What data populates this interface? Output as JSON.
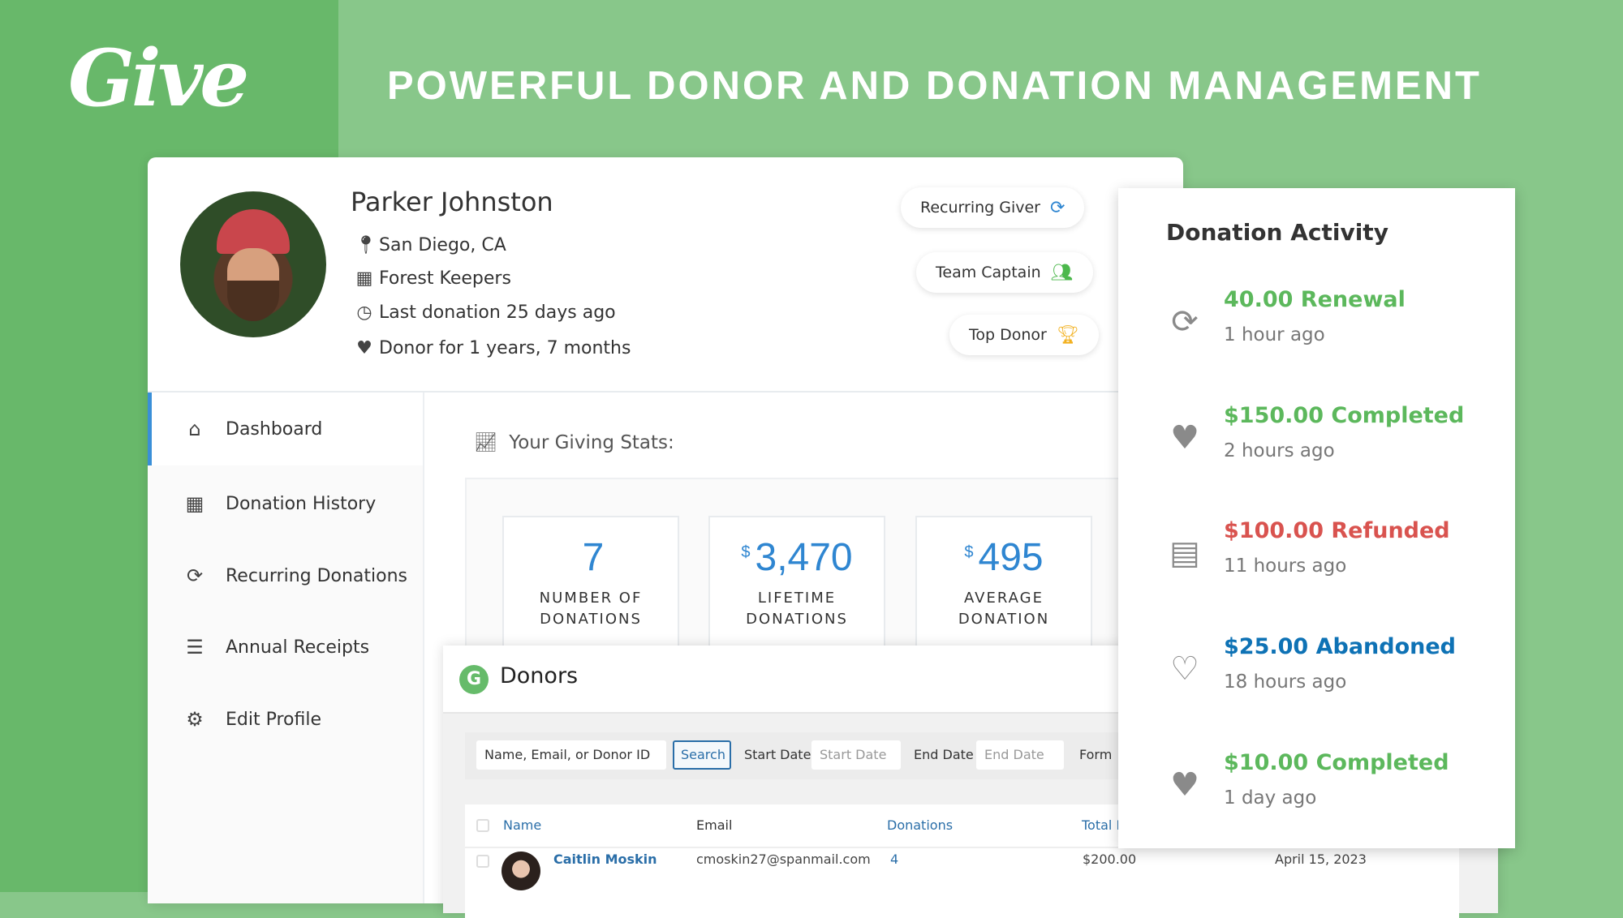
{
  "brand": {
    "logo_text": "Give",
    "headline": "POWERFUL DONOR AND DONATION MANAGEMENT"
  },
  "profile": {
    "name": "Parker Johnston",
    "location": "San Diego, CA",
    "organization": "Forest Keepers",
    "last_donation": "Last donation 25 days ago",
    "donor_since": "Donor for 1 years, 7 months",
    "badges": [
      {
        "label": "Recurring Giver",
        "icon": "sync-icon",
        "color": "#2f86d1"
      },
      {
        "label": "Team Captain",
        "icon": "users-icon",
        "color": "#4cb84c"
      },
      {
        "label": "Top Donor",
        "icon": "trophy-icon",
        "color": "#f2b01e"
      }
    ]
  },
  "sidebar": {
    "items": [
      {
        "label": "Dashboard",
        "icon": "home-icon",
        "active": true
      },
      {
        "label": "Donation History",
        "icon": "calendar-icon"
      },
      {
        "label": "Recurring Donations",
        "icon": "sync-icon"
      },
      {
        "label": "Annual Receipts",
        "icon": "receipt-icon"
      },
      {
        "label": "Edit Profile",
        "icon": "gear-icon"
      }
    ]
  },
  "stats": {
    "title": "Your Giving Stats:",
    "cards": [
      {
        "currency": "",
        "value": "7",
        "label1": "NUMBER OF",
        "label2": "DONATIONS"
      },
      {
        "currency": "$",
        "value": "3,470",
        "label1": "LIFETIME",
        "label2": "DONATIONS"
      },
      {
        "currency": "$",
        "value": "495",
        "label1": "AVERAGE",
        "label2": "DONATION"
      }
    ]
  },
  "donors": {
    "title": "Donors",
    "search_placeholder": "Name, Email, or Donor ID",
    "search_label": "Search",
    "start_date_label": "Start Date",
    "start_date_placeholder": "Start Date",
    "end_date_label": "End Date",
    "end_date_placeholder": "End Date",
    "form_label": "Form",
    "columns": [
      "Name",
      "Email",
      "Donations",
      "Total D"
    ],
    "rows": [
      {
        "name": "Caitlin Moskin",
        "email": "cmoskin27@spanmail.com",
        "donations": "4",
        "total": "$200.00",
        "date": "April 15, 2023"
      }
    ]
  },
  "activity": {
    "title": "Donation Activity",
    "items": [
      {
        "amount": "40.00 Renewal",
        "time": "1 hour ago",
        "icon": "sync-icon",
        "color": "#5cb85c"
      },
      {
        "amount": "$150.00 Completed",
        "time": "2 hours ago",
        "icon": "heart-icon",
        "color": "#5cb85c"
      },
      {
        "amount": "$100.00 Refunded",
        "time": "11 hours ago",
        "icon": "receipt-icon",
        "color": "#d9534f"
      },
      {
        "amount": "$25.00 Abandoned",
        "time": "18 hours ago",
        "icon": "heart-outline-icon",
        "color": "#0e72b5"
      },
      {
        "amount": "$10.00 Completed",
        "time": "1 day ago",
        "icon": "heart-icon",
        "color": "#5cb85c"
      }
    ]
  }
}
